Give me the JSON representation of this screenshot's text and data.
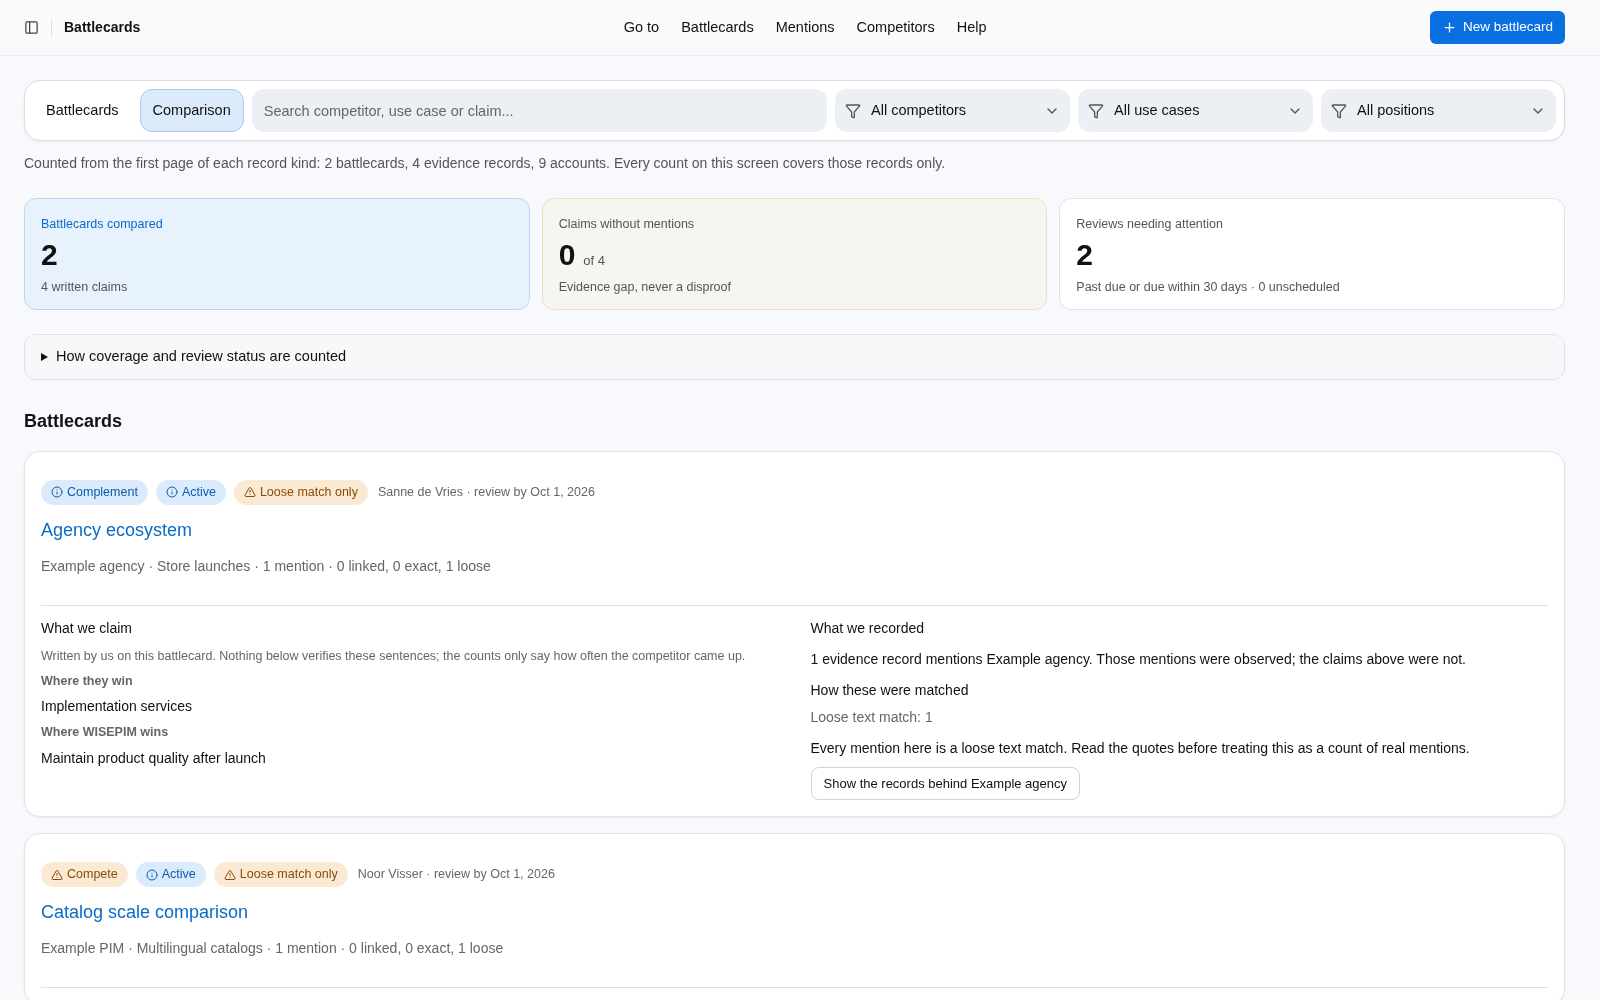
{
  "header": {
    "title": "Battlecards",
    "nav": [
      "Go to",
      "Battlecards",
      "Mentions",
      "Competitors",
      "Help"
    ],
    "new_button": "New battlecard"
  },
  "view_tabs": [
    {
      "label": "Battlecards",
      "selected": false
    },
    {
      "label": "Comparison",
      "selected": true
    }
  ],
  "search": {
    "placeholder": "Search competitor, use case or claim..."
  },
  "filters": [
    "All competitors",
    "All use cases",
    "All positions"
  ],
  "note": "Counted from the first page of each record kind: 2 battlecards, 4 evidence records, 9 accounts. Every count on this screen covers those records only.",
  "stats": [
    {
      "kind": "info",
      "label": "Battlecards compared",
      "value": "2",
      "sub": "4 written claims"
    },
    {
      "kind": "warning",
      "label": "Claims without mentions",
      "value": "0",
      "of": "of 4",
      "sub": "Evidence gap, never a disproof"
    },
    {
      "kind": "plain",
      "label": "Reviews needing attention",
      "value": "2",
      "sub": "Past due or due within 30 days · 0 unscheduled"
    }
  ],
  "disclosure": {
    "label": "How coverage and review status are counted",
    "expanded": false
  },
  "section_title": "Battlecards",
  "cards": [
    {
      "tags": [
        {
          "kind": "info",
          "label": "Complement"
        },
        {
          "kind": "info",
          "label": "Active"
        },
        {
          "kind": "warning",
          "label": "Loose match only"
        }
      ],
      "owner": "Sanne de Vries · review by Oct 1, 2026",
      "title": "Agency ecosystem",
      "meta": "Example agency · Store launches · 1 mention · 0 linked, 0 exact, 1 loose",
      "claim": {
        "heading": "What we claim",
        "intro": "Written by us on this battlecard. Nothing below verifies these sentences; the counts only say how often the competitor came up.",
        "items": [
          {
            "label": "Where they win",
            "text": "Implementation services"
          },
          {
            "label": "Where WISEPIM wins",
            "text": "Maintain product quality after launch"
          }
        ]
      },
      "recorded": {
        "heading": "What we recorded",
        "text": "1 evidence record mentions Example agency. Those mentions were observed; the claims above were not.",
        "match_heading": "How these were matched",
        "match": "Loose text match: 1",
        "warning": "Every mention here is a loose text match. Read the quotes before treating this as a count of real mentions.",
        "button": "Show the records behind Example agency"
      }
    },
    {
      "tags": [
        {
          "kind": "warning",
          "label": "Compete"
        },
        {
          "kind": "info",
          "label": "Active"
        },
        {
          "kind": "warning",
          "label": "Loose match only"
        }
      ],
      "owner": "Noor Visser · review by Oct 1, 2026",
      "title": "Catalog scale comparison",
      "meta": "Example PIM · Multilingual catalogs · 1 mention · 0 linked, 0 exact, 1 loose"
    }
  ]
}
